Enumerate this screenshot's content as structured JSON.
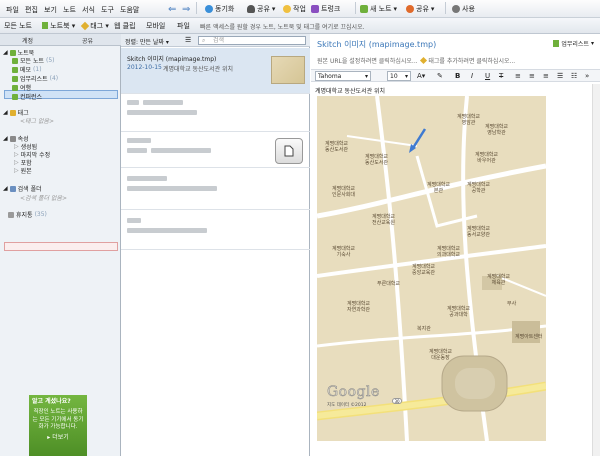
{
  "menu": [
    "파일",
    "편집",
    "보기",
    "노트",
    "서식",
    "도구",
    "도움말"
  ],
  "toolbar": {
    "sync": "동기화",
    "share": "공유",
    "work": "작업",
    "trunk": "트렁크",
    "new_note": "새 노트",
    "share2": "공유",
    "account": "사용"
  },
  "toolbar2": {
    "all_notes": "모든 노트",
    "notebook": "노트북",
    "tag": "태그",
    "web_clip": "웹 클립",
    "mobile": "모바일",
    "file": "파일",
    "hint": "빠른 액세스를 원할 경우 노트, 노트북 및 태그를 여기로 끄십시오."
  },
  "left": {
    "tab_account": "계정",
    "tab_shared": "공유",
    "notebooks_header": "노트북",
    "notebooks": [
      {
        "label": "모든 노트",
        "count": "(5)"
      },
      {
        "label": "메모",
        "count": "(1)"
      },
      {
        "label": "업무리스트",
        "count": "(4)"
      },
      {
        "label": "여행",
        "count": ""
      },
      {
        "label": "컨퍼런스",
        "count": ""
      }
    ],
    "tags_header": "태그",
    "tags_empty": "<태그 없음>",
    "attributes_header": "속성",
    "attributes": [
      "생성됨",
      "마지막 수정",
      "포함",
      "원본"
    ],
    "saved_search_header": "검색 폴더",
    "saved_search_empty": "<검색 폴더 없음>",
    "trash_label": "휴지통",
    "trash_count": "(35)",
    "promo_title": "알고 계셨나요?",
    "promo_body": "직장인 노트는 사용하는 모든 기기에서 동기화가 가능합니다.",
    "promo_more": "더보기"
  },
  "middle": {
    "sort": "정렬: 만든 날짜",
    "search_placeholder": "검색",
    "notes": [
      {
        "title": "Skitch 이미지 (mapimage.tmp)",
        "date": "2012-10-15",
        "snippet": "계명대학교 동산도서관 위치"
      }
    ]
  },
  "right": {
    "title": "Skitch 이미지 (mapimage.tmp)",
    "notebook": "업무리스트",
    "url_hint": "원본 URL을 설정하려면 클릭하십시오...",
    "tag_hint": "태그를 추가하려면 클릭하십시오...",
    "font": "Tahoma",
    "size": "10",
    "body_text": "계명대학교 동산도서관 위치"
  },
  "map": {
    "labels": [
      "계명대학교\n영암관",
      "계명대학교\n동산도서관",
      "계명대학교\n바우어관",
      "계명대학교\n동산도서관",
      "계명대학교\n본관",
      "계명대학교\n공학관",
      "계명대학교\n영남학관",
      "계명대학교\n동서교양관",
      "계명대학교\n전산교육원",
      "계명대학교\n체육관",
      "계명대학교\n자연과학관",
      "계명대학교\n의과대학교",
      "계명대학교\n대운동장",
      "계명아트센터",
      "계명대학교\n중앙교육관",
      "계명대학교\n기숙사",
      "계명대학교\n인문사회대",
      "계명대학교\n공과대학",
      "푸른대학교",
      "복지관",
      "부사"
    ],
    "google": "Google",
    "copyright": "지도 데이터 ©2012",
    "road": "30"
  }
}
